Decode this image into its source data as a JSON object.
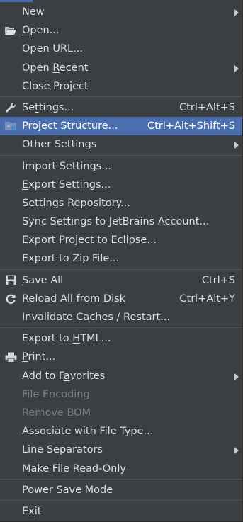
{
  "menu": {
    "new": {
      "label": "New"
    },
    "open": {
      "pre": "",
      "mn": "O",
      "post": "pen...",
      "icon": "folder-open-icon"
    },
    "open_url": {
      "label": "Open URL..."
    },
    "open_recent": {
      "pre": "Open ",
      "mn": "R",
      "post": "ecent"
    },
    "close_project": {
      "label": "Close Project"
    },
    "settings": {
      "pre": "Se",
      "mn": "t",
      "post": "tings...",
      "shortcut": "Ctrl+Alt+S",
      "icon": "wrench-icon"
    },
    "project_structure": {
      "label": "Project Structure...",
      "shortcut": "Ctrl+Alt+Shift+S",
      "icon": "project-structure-icon"
    },
    "other_settings": {
      "label": "Other Settings"
    },
    "import_settings": {
      "label": "Import Settings..."
    },
    "export_settings": {
      "pre": "",
      "mn": "E",
      "post": "xport Settings..."
    },
    "settings_repository": {
      "label": "Settings Repository..."
    },
    "sync_settings": {
      "label": "Sync Settings to JetBrains Account..."
    },
    "export_eclipse": {
      "label": "Export Project to Eclipse..."
    },
    "export_zip": {
      "label": "Export to Zip File..."
    },
    "save_all": {
      "pre": "",
      "mn": "S",
      "post": "ave All",
      "shortcut": "Ctrl+S",
      "icon": "save-icon"
    },
    "reload_all": {
      "label": "Reload All from Disk",
      "shortcut": "Ctrl+Alt+Y",
      "icon": "reload-icon"
    },
    "invalidate_caches": {
      "label": "Invalidate Caches / Restart..."
    },
    "export_html": {
      "pre": "Export to ",
      "mn": "H",
      "post": "TML..."
    },
    "print": {
      "pre": "",
      "mn": "P",
      "post": "rint...",
      "icon": "printer-icon"
    },
    "add_favorites": {
      "pre": "Add to F",
      "mn": "a",
      "post": "vorites"
    },
    "file_encoding": {
      "label": "File Encoding"
    },
    "remove_bom": {
      "label": "Remove BOM"
    },
    "associate_file_type": {
      "label": "Associate with File Type..."
    },
    "line_separators": {
      "label": "Line Separators"
    },
    "make_read_only": {
      "label": "Make File Read-Only"
    },
    "power_save": {
      "label": "Power Save Mode"
    },
    "exit": {
      "pre": "E",
      "mn": "x",
      "post": "it"
    }
  },
  "colors": {
    "background": "#3c3f41",
    "selection": "#4b6eaf",
    "text": "#dcdcdc",
    "disabled": "#7c7c7c"
  }
}
